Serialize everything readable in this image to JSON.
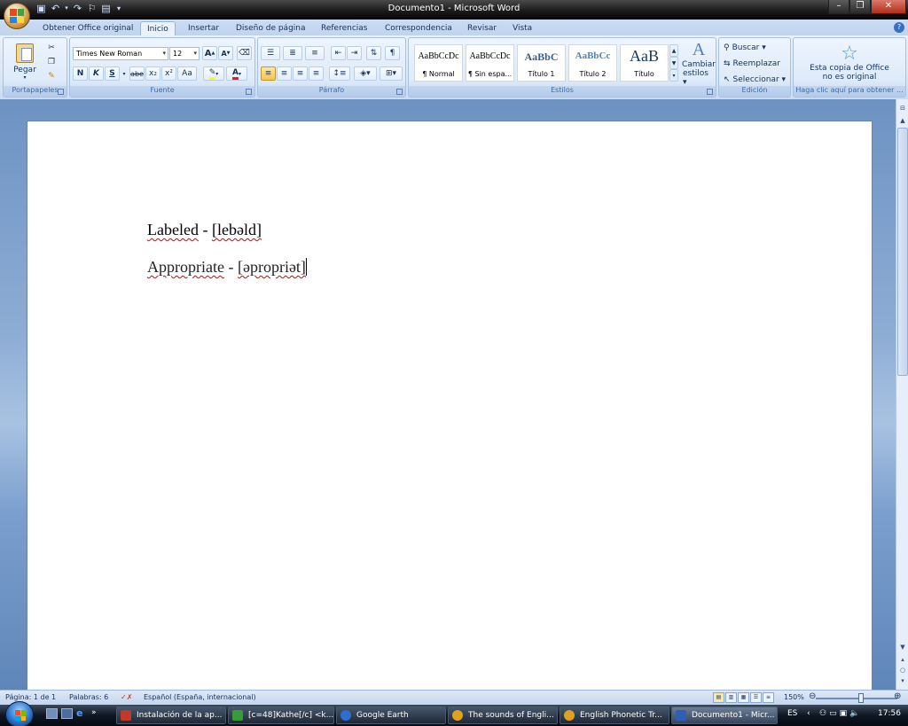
{
  "window": {
    "title": "Documento1 - Microsoft Word",
    "controls": {
      "minimize": "–",
      "maximize": "❐",
      "close": "✕"
    }
  },
  "quick_access": [
    "save-icon",
    "undo-icon",
    "redo-icon",
    "customize-icon",
    "new-doc-icon"
  ],
  "tabs": [
    {
      "label": "Obtener Office original"
    },
    {
      "label": "Inicio",
      "active": true
    },
    {
      "label": "Insertar"
    },
    {
      "label": "Diseño de página"
    },
    {
      "label": "Referencias"
    },
    {
      "label": "Correspondencia"
    },
    {
      "label": "Revisar"
    },
    {
      "label": "Vista"
    }
  ],
  "ribbon": {
    "clipboard": {
      "paste_label": "Pegar",
      "group_label": "Portapapeles"
    },
    "font": {
      "font_name": "Times New Roman",
      "font_size": "12",
      "bold": "N",
      "italic": "K",
      "underline": "S",
      "strikethrough": "abe",
      "subscript": "x₂",
      "superscript": "x²",
      "change_case": "Aa",
      "grow": "A",
      "shrink": "A",
      "group_label": "Fuente"
    },
    "paragraph": {
      "group_label": "Párrafo"
    },
    "styles": {
      "items": [
        {
          "sample": "AaBbCcDc",
          "name": "¶ Normal"
        },
        {
          "sample": "AaBbCcDc",
          "name": "¶ Sin espa..."
        },
        {
          "sample": "AaBbC",
          "name": "Título 1"
        },
        {
          "sample": "AaBbCc",
          "name": "Título 2"
        },
        {
          "sample": "AaB",
          "name": "Título"
        }
      ],
      "change_styles_line1": "Cambiar",
      "change_styles_line2": "estilos",
      "group_label": "Estilos"
    },
    "editing": {
      "find": "Buscar",
      "replace": "Reemplazar",
      "select": "Seleccionar",
      "group_label": "Edición"
    },
    "office": {
      "line1": "Esta copia de Office",
      "line2": "no es original",
      "group_label": "Haga clic aquí para obtener ..."
    }
  },
  "document": {
    "line1_word": "Labeled",
    "line1_sep": " - ",
    "line1_ipa": "[lebəld]",
    "line2_word": "Appropriate",
    "line2_sep": " - ",
    "line2_ipa": "[əpropriət]"
  },
  "status": {
    "page": "Página: 1 de 1",
    "words": "Palabras: 6",
    "language": "Español (España, internacional)",
    "zoom": "150%"
  },
  "taskbar": {
    "items": [
      {
        "label": "Instalación de la ap...",
        "icon_color": "#c0392b"
      },
      {
        "label": "[c=48]Kathe[/c] <k...",
        "icon_color": "#3a9a3a"
      },
      {
        "label": "Google Earth",
        "icon_color": "#2a6fd1"
      },
      {
        "label": "The sounds of Engli...",
        "icon_color": "#e0a020"
      },
      {
        "label": "English Phonetic Tr...",
        "icon_color": "#e0a020"
      },
      {
        "label": "Documento1 - Micr...",
        "icon_color": "#2f5fb3",
        "active": true
      }
    ],
    "lang": "ES",
    "time": "17:56"
  }
}
